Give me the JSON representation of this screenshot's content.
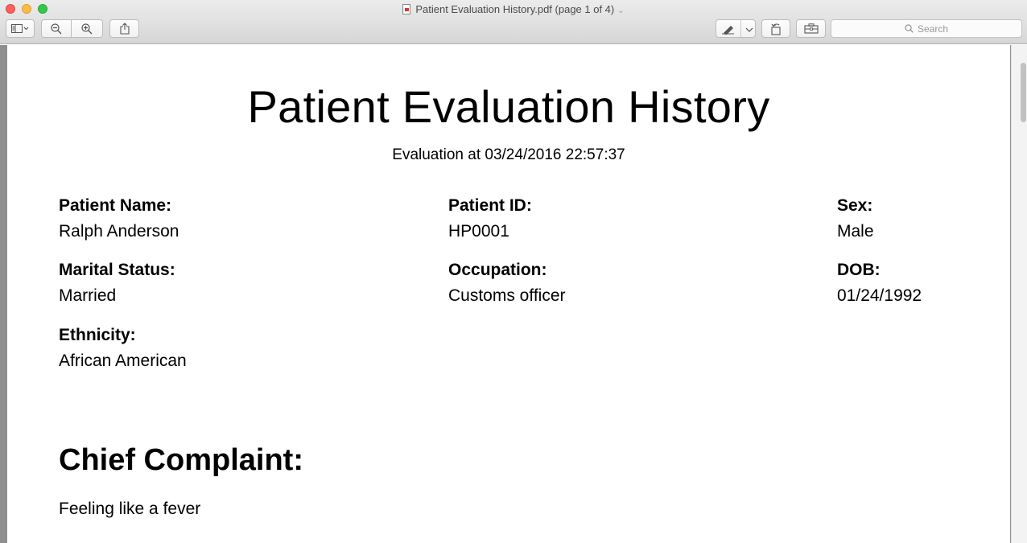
{
  "window": {
    "title": "Patient Evaluation History.pdf (page 1 of 4)"
  },
  "toolbar": {
    "search_placeholder": "Search"
  },
  "document": {
    "title": "Patient Evaluation History",
    "subtitle": "Evaluation at 03/24/2016 22:57:37",
    "fields": {
      "patient_name": {
        "label": "Patient Name:",
        "value": "Ralph Anderson"
      },
      "patient_id": {
        "label": "Patient ID:",
        "value": "HP0001"
      },
      "sex": {
        "label": "Sex:",
        "value": "Male"
      },
      "marital_status": {
        "label": "Marital Status:",
        "value": "Married"
      },
      "occupation": {
        "label": "Occupation:",
        "value": "Customs officer"
      },
      "dob": {
        "label": "DOB:",
        "value": "01/24/1992"
      },
      "ethnicity": {
        "label": "Ethnicity:",
        "value": "African American"
      }
    },
    "chief_complaint": {
      "heading": "Chief Complaint:",
      "text": "Feeling like a fever"
    }
  }
}
